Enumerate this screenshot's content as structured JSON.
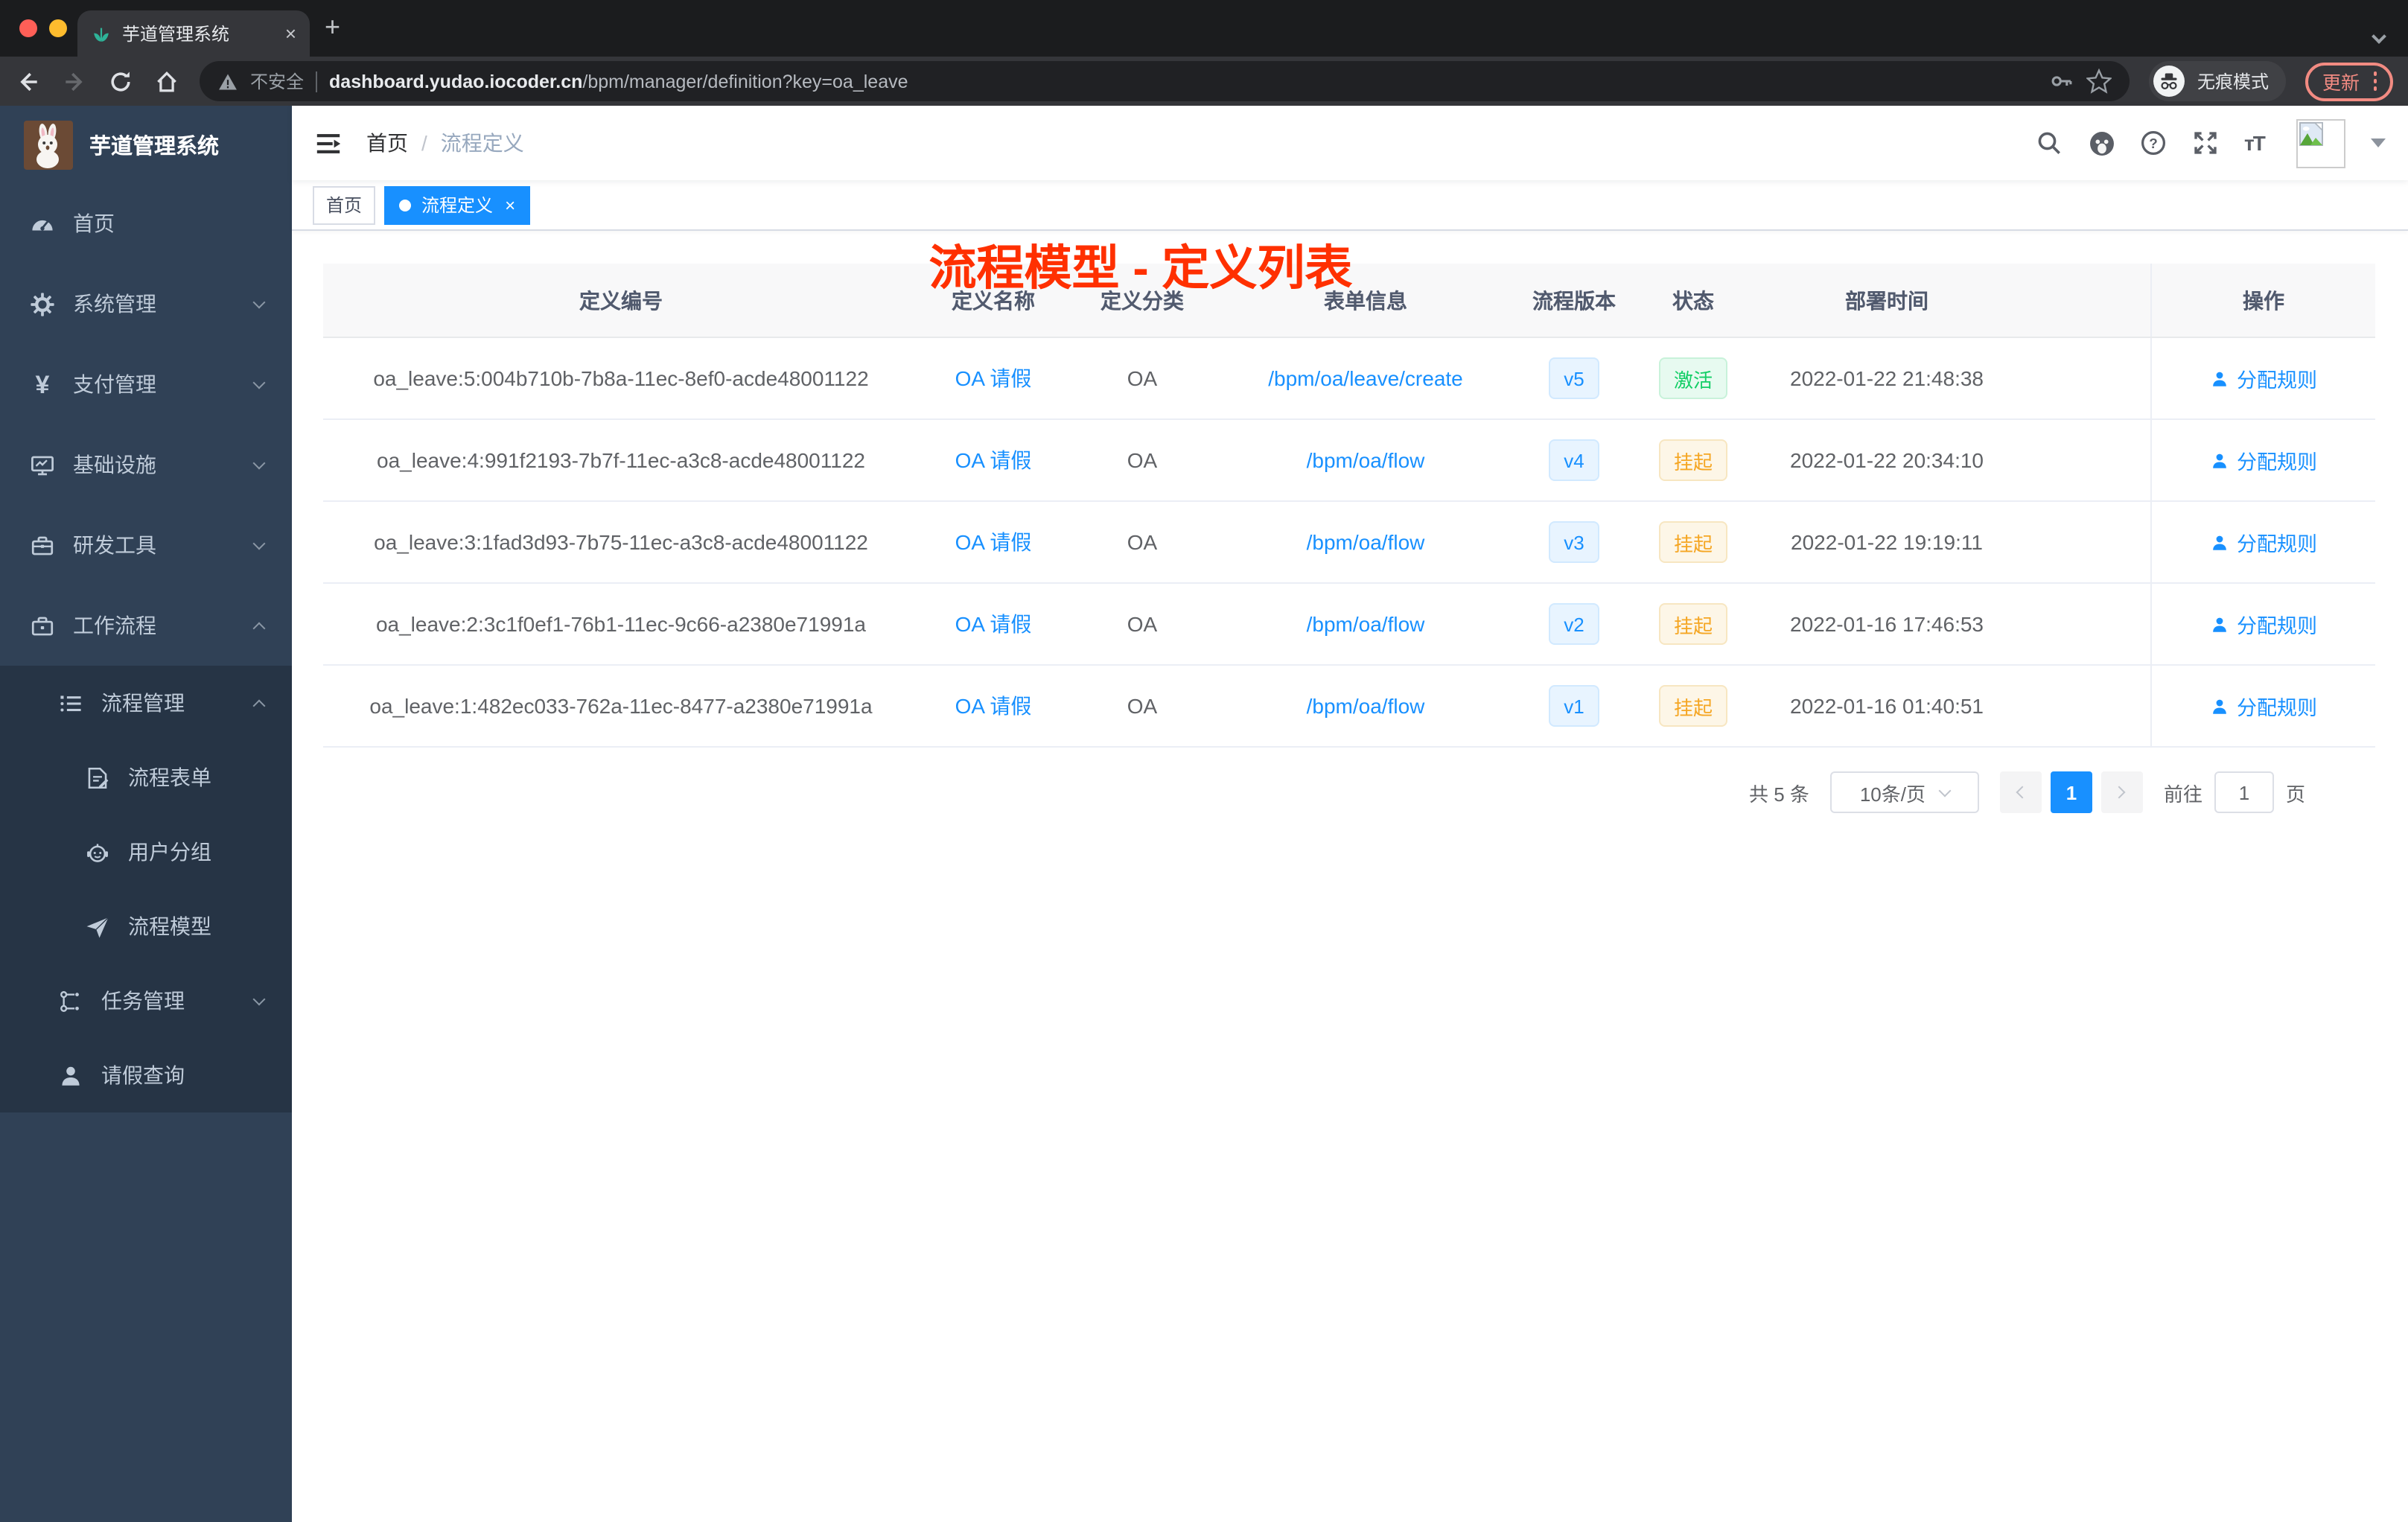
{
  "browser": {
    "tab_title": "芋道管理系统",
    "tab_close": "×",
    "new_tab": "+",
    "security_label": "不安全",
    "url_host": "dashboard.yudao.iocoder.cn",
    "url_path": "/bpm/manager/definition?key=oa_leave",
    "incognito_label": "无痕模式",
    "update_label": "更新"
  },
  "sidebar": {
    "app_title": "芋道管理系统",
    "menu": [
      {
        "label": "首页"
      },
      {
        "label": "系统管理"
      },
      {
        "label": "支付管理"
      },
      {
        "label": "基础设施"
      },
      {
        "label": "研发工具"
      },
      {
        "label": "工作流程"
      },
      {
        "label": "流程管理"
      },
      {
        "label": "流程表单"
      },
      {
        "label": "用户分组"
      },
      {
        "label": "流程模型"
      },
      {
        "label": "任务管理"
      },
      {
        "label": "请假查询"
      }
    ]
  },
  "header": {
    "breadcrumb_home": "首页",
    "breadcrumb_sep": "/",
    "breadcrumb_current": "流程定义",
    "annotation": "流程模型 - 定义列表"
  },
  "tags": [
    {
      "label": "首页"
    },
    {
      "label": "流程定义",
      "close": "×"
    }
  ],
  "table": {
    "columns": [
      "定义编号",
      "定义名称",
      "定义分类",
      "表单信息",
      "流程版本",
      "状态",
      "部署时间",
      "操作"
    ],
    "rows": [
      {
        "id": "oa_leave:5:004b710b-7b8a-11ec-8ef0-acde48001122",
        "name": "OA 请假",
        "category": "OA",
        "form": "/bpm/oa/leave/create",
        "version": "v5",
        "status": "激活",
        "status_type": "success",
        "deploy_time": "2022-01-22 21:48:38",
        "action": "分配规则"
      },
      {
        "id": "oa_leave:4:991f2193-7b7f-11ec-a3c8-acde48001122",
        "name": "OA 请假",
        "category": "OA",
        "form": "/bpm/oa/flow",
        "version": "v4",
        "status": "挂起",
        "status_type": "warning",
        "deploy_time": "2022-01-22 20:34:10",
        "action": "分配规则"
      },
      {
        "id": "oa_leave:3:1fad3d93-7b75-11ec-a3c8-acde48001122",
        "name": "OA 请假",
        "category": "OA",
        "form": "/bpm/oa/flow",
        "version": "v3",
        "status": "挂起",
        "status_type": "warning",
        "deploy_time": "2022-01-22 19:19:11",
        "action": "分配规则"
      },
      {
        "id": "oa_leave:2:3c1f0ef1-76b1-11ec-9c66-a2380e71991a",
        "name": "OA 请假",
        "category": "OA",
        "form": "/bpm/oa/flow",
        "version": "v2",
        "status": "挂起",
        "status_type": "warning",
        "deploy_time": "2022-01-16 17:46:53",
        "action": "分配规则"
      },
      {
        "id": "oa_leave:1:482ec033-762a-11ec-8477-a2380e71991a",
        "name": "OA 请假",
        "category": "OA",
        "form": "/bpm/oa/flow",
        "version": "v1",
        "status": "挂起",
        "status_type": "warning",
        "deploy_time": "2022-01-16 01:40:51",
        "action": "分配规则"
      }
    ]
  },
  "pagination": {
    "total": "共 5 条",
    "page_size": "10条/页",
    "page": "1",
    "goto_label": "前往",
    "goto_value": "1",
    "page_unit": "页"
  },
  "colors": {
    "accent": "#1890ff",
    "success": "#13ce66",
    "warning": "#f5a623",
    "annotation_red": "#ff3000",
    "sidebar_bg": "#304156",
    "submenu_bg": "#263445"
  }
}
